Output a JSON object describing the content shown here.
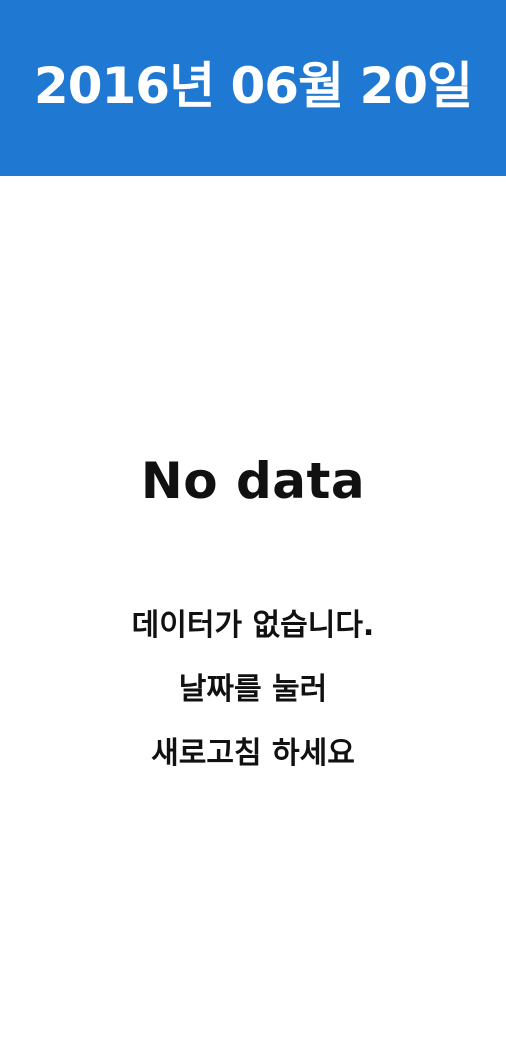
{
  "header": {
    "date_label": "2016년 06월 20일"
  },
  "empty_state": {
    "title": "No data",
    "message_lines": [
      "데이터가 없습니다.",
      "날짜를 눌러",
      "새로고침 하세요"
    ]
  },
  "colors": {
    "header_background": "#1f78d1",
    "header_text": "#ffffff",
    "body_background": "#ffffff",
    "body_text": "#111111"
  }
}
